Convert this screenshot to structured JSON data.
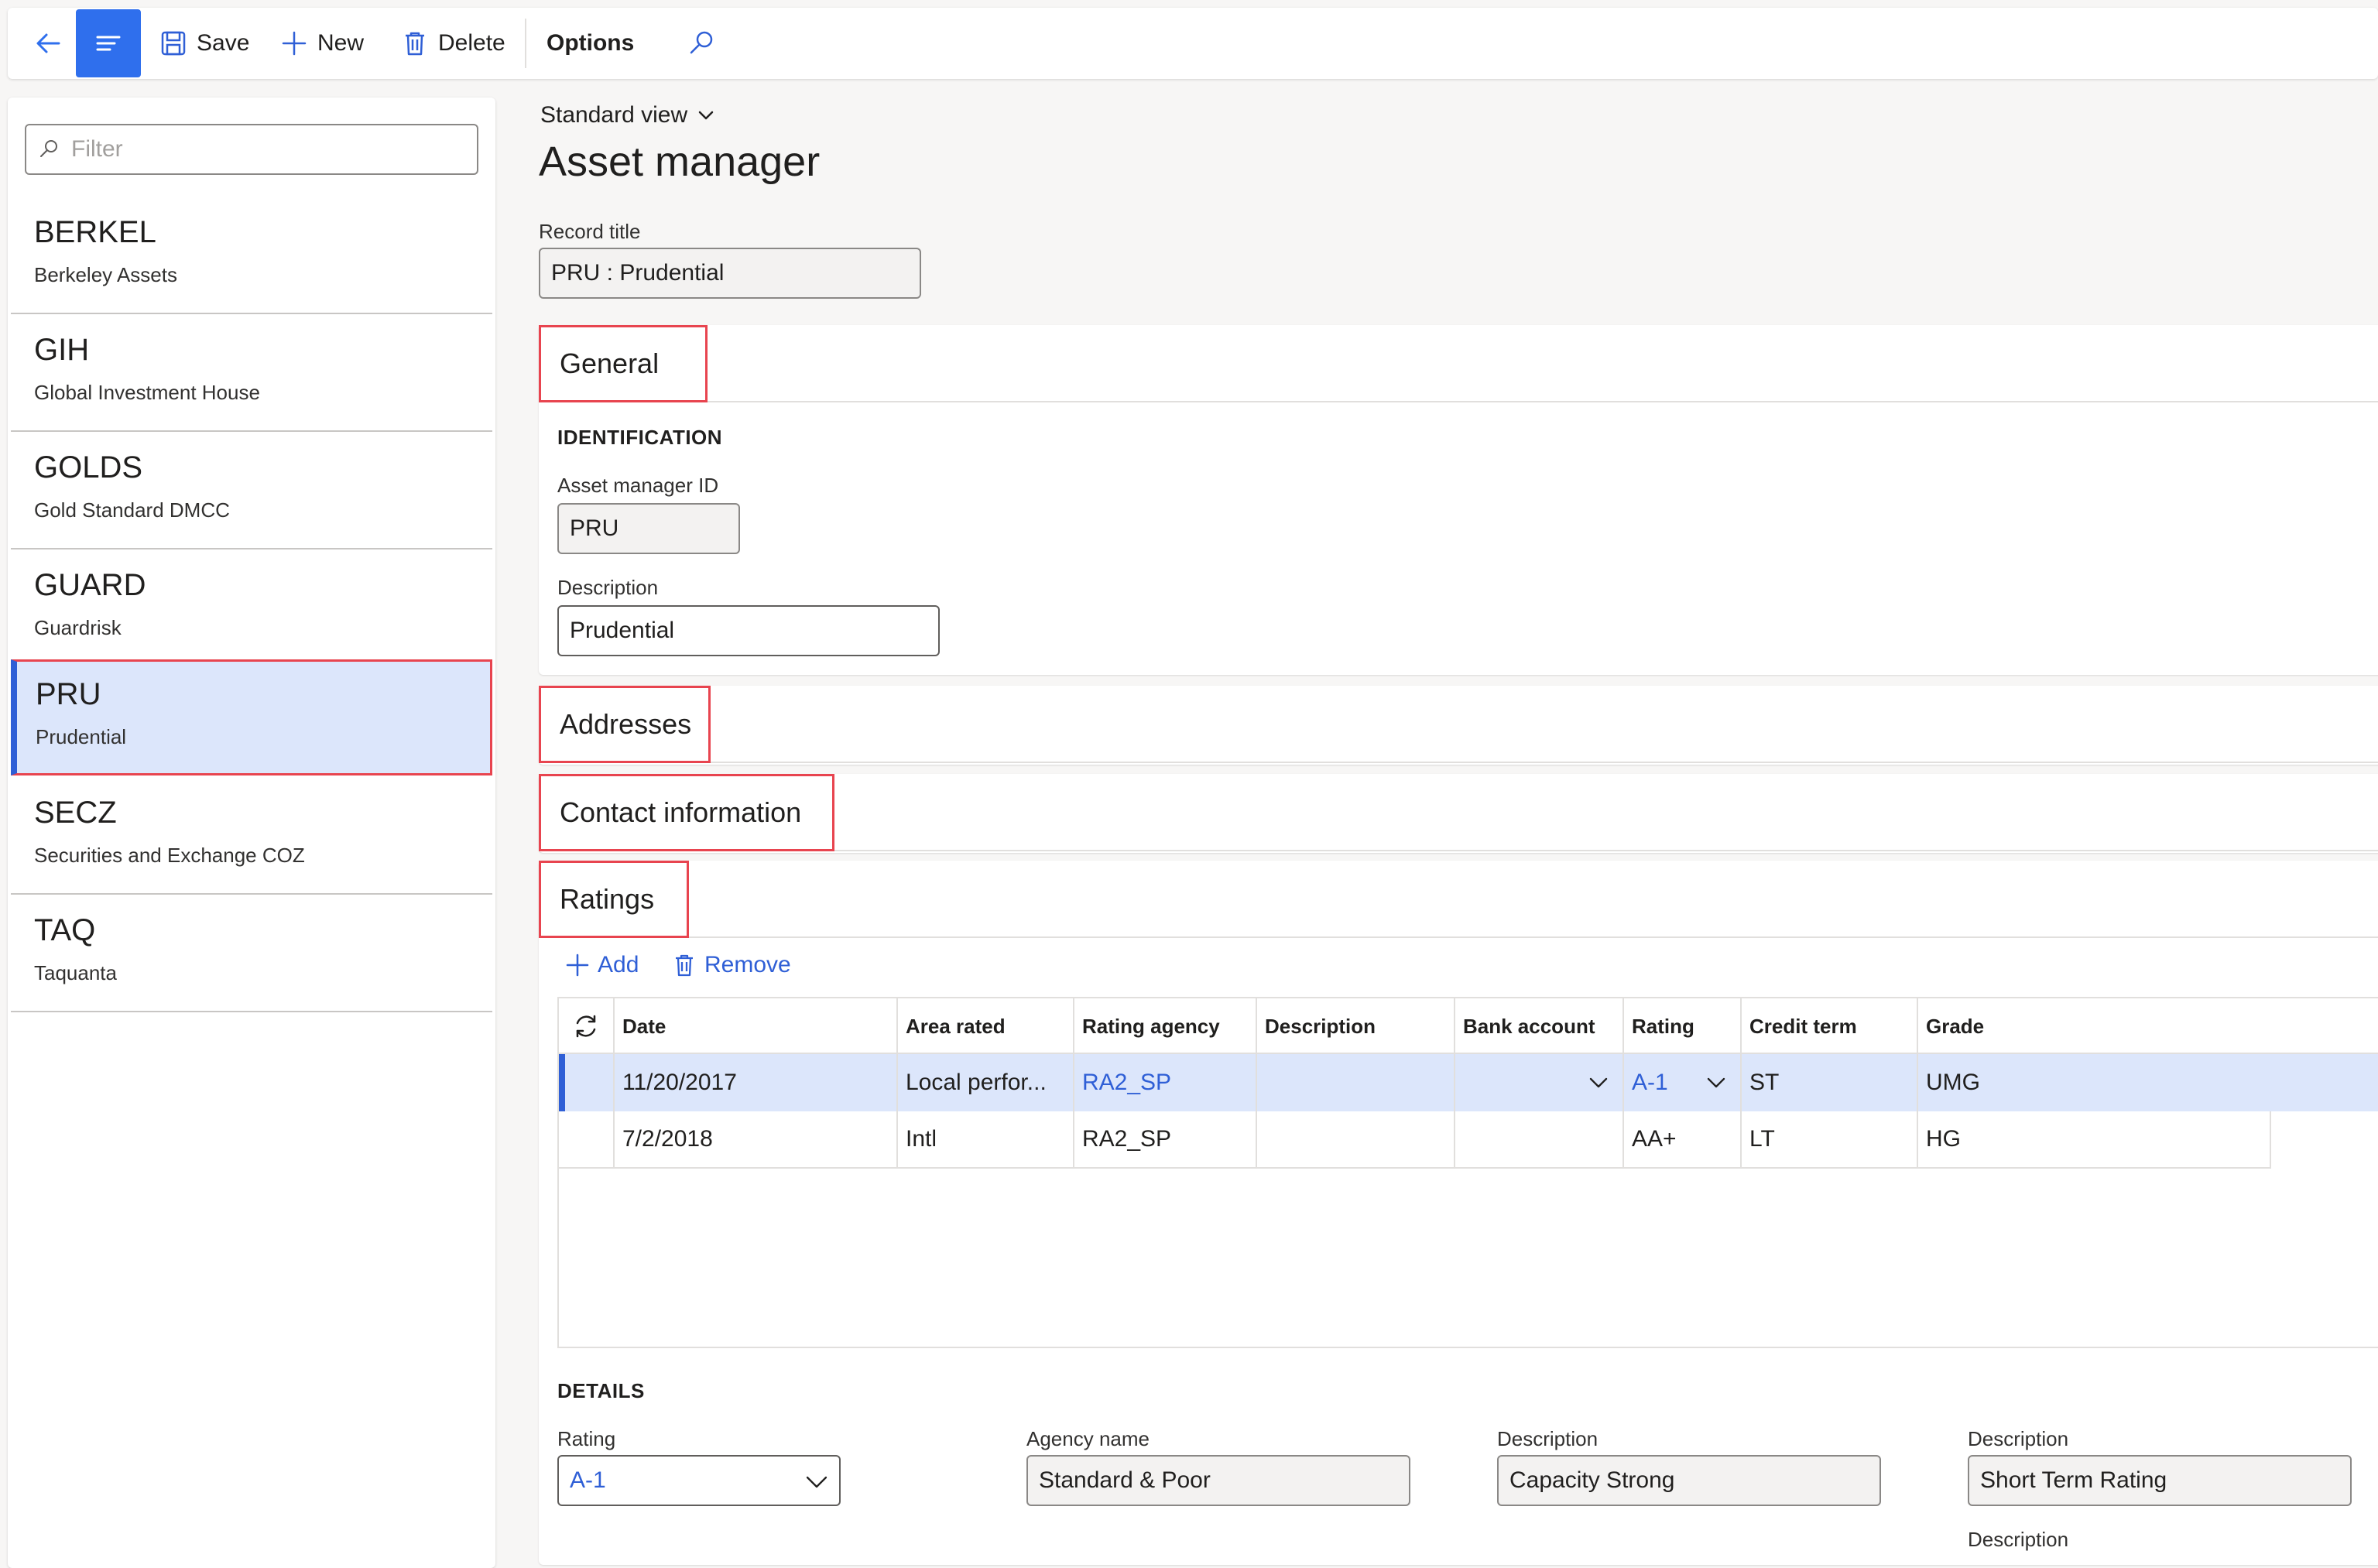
{
  "toolbar": {
    "save_label": "Save",
    "new_label": "New",
    "delete_label": "Delete",
    "options_label": "Options"
  },
  "filter": {
    "placeholder": "Filter"
  },
  "list": [
    {
      "code": "BERKEL",
      "name": "Berkeley Assets"
    },
    {
      "code": "GIH",
      "name": "Global Investment House"
    },
    {
      "code": "GOLDS",
      "name": "Gold Standard DMCC"
    },
    {
      "code": "GUARD",
      "name": "Guardrisk"
    },
    {
      "code": "PRU",
      "name": "Prudential"
    },
    {
      "code": "SECZ",
      "name": "Securities and Exchange COZ"
    },
    {
      "code": "TAQ",
      "name": "Taquanta"
    }
  ],
  "view": {
    "label": "Standard view"
  },
  "page": {
    "title": "Asset manager",
    "record_title_label": "Record title",
    "record_title_value": "PRU : Prudential"
  },
  "tabs": {
    "general": "General",
    "addresses": "Addresses",
    "contact": "Contact information",
    "ratings": "Ratings"
  },
  "general": {
    "section": "IDENTIFICATION",
    "id_label": "Asset manager ID",
    "id_value": "PRU",
    "desc_label": "Description",
    "desc_value": "Prudential"
  },
  "ratings": {
    "add_label": "Add",
    "remove_label": "Remove",
    "columns": [
      "Date",
      "Area rated",
      "Rating agency",
      "Description",
      "Bank account",
      "Rating",
      "Credit term",
      "Grade"
    ],
    "rows": [
      {
        "date": "11/20/2017",
        "area": "Local perfor...",
        "agency": "RA2_SP",
        "description": "",
        "bank": "",
        "rating": "A-1",
        "credit_term": "ST",
        "grade": "UMG"
      },
      {
        "date": "7/2/2018",
        "area": "Intl",
        "agency": "RA2_SP",
        "description": "",
        "bank": "",
        "rating": "AA+",
        "credit_term": "LT",
        "grade": "HG"
      }
    ]
  },
  "details": {
    "section": "DETAILS",
    "rating_label": "Rating",
    "rating_value": "A-1",
    "agency_label": "Agency name",
    "agency_value": "Standard & Poor",
    "desc1_label": "Description",
    "desc1_value": "Capacity Strong",
    "desc2_label": "Description",
    "desc2_value": "Short Term Rating",
    "desc3_label": "Description"
  },
  "colors": {
    "accent": "#2f6fed",
    "link": "#2f5fd6",
    "highlight": "#e8444f",
    "selected_bg": "#dce6fb"
  },
  "icons": [
    "back-arrow-icon",
    "list-menu-icon",
    "save-icon",
    "plus-icon",
    "trash-icon",
    "search-icon",
    "chevron-down-icon",
    "refresh-icon"
  ]
}
